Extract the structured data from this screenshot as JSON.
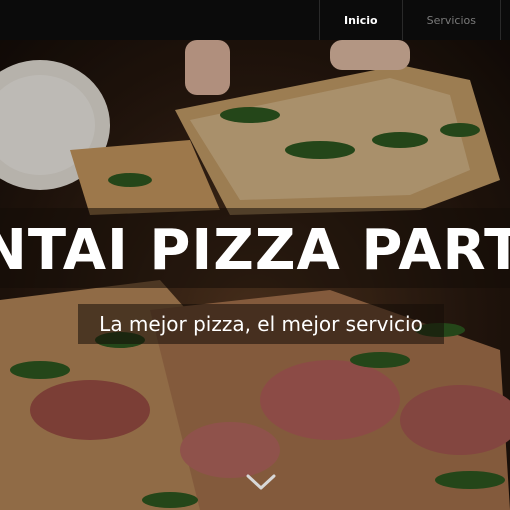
{
  "nav": {
    "items": [
      {
        "label": "Inicio",
        "active": true
      },
      {
        "label": "Servicios",
        "active": false
      }
    ]
  },
  "hero": {
    "title": "NTAI PIZZA PART",
    "subtitle": "La mejor pizza, el mejor servicio",
    "scroll_icon": "chevron-down-icon"
  },
  "colors": {
    "nav_bg": "#0b0b0b",
    "nav_active": "#ffffff",
    "nav_inactive": "#7a7a7a",
    "text": "#ffffff"
  }
}
